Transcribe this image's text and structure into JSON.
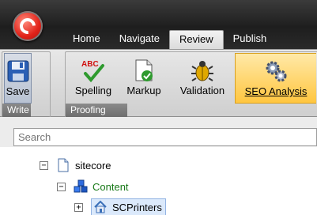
{
  "tabs": [
    {
      "label": "Home"
    },
    {
      "label": "Navigate"
    },
    {
      "label": "Review",
      "active": true
    },
    {
      "label": "Publish"
    }
  ],
  "ribbon": {
    "write_group": {
      "label": "Write",
      "save_label": "Save"
    },
    "proofing_group": {
      "label": "Proofing",
      "buttons": [
        {
          "label": "Spelling",
          "icon": "spelling-abc-check-icon"
        },
        {
          "label": "Markup",
          "icon": "markup-document-icon"
        },
        {
          "label": "Validation",
          "icon": "validation-bug-icon"
        },
        {
          "label": "SEO Analysis",
          "icon": "seo-gears-icon",
          "selected": true
        }
      ]
    }
  },
  "search": {
    "placeholder": "Search"
  },
  "tree": {
    "items": [
      {
        "label": "sitecore",
        "expander": "−",
        "icon": "page-icon"
      },
      {
        "label": "Content",
        "expander": "−",
        "icon": "content-cubes-icon"
      },
      {
        "label": "SCPrinters",
        "expander": "+",
        "icon": "home-icon",
        "selected": true
      }
    ]
  },
  "colors": {
    "title_bar": "#2a2a2a",
    "selected_button": "#ffc640",
    "content_text": "#1a7a1a",
    "selection": "#dbe9fb"
  }
}
